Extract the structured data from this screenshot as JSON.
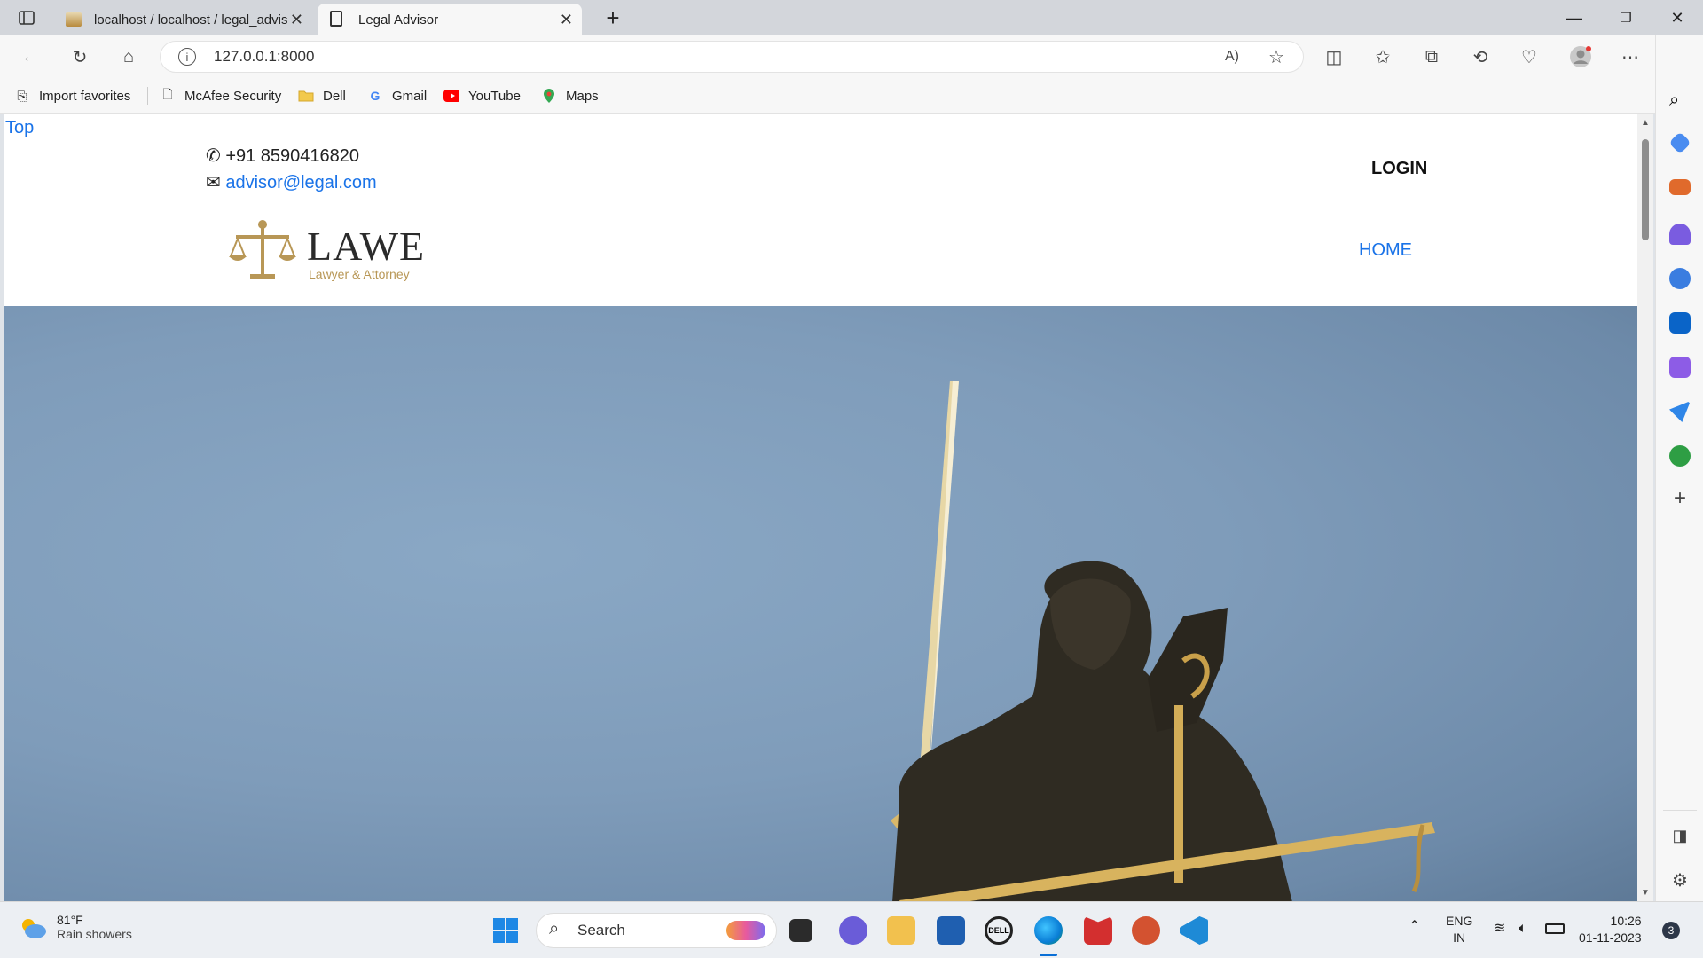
{
  "browser": {
    "tabs": [
      {
        "title": "localhost / localhost / legal_advis"
      },
      {
        "title": "Legal Advisor"
      }
    ],
    "url": "127.0.0.1:8000",
    "favorites": [
      {
        "label": "Import favorites",
        "icon": "import-icon"
      },
      {
        "label": "McAfee Security",
        "icon": "page-icon"
      },
      {
        "label": "Dell",
        "icon": "folder-icon"
      },
      {
        "label": "Gmail",
        "icon": "google-icon"
      },
      {
        "label": "YouTube",
        "icon": "youtube-icon"
      },
      {
        "label": "Maps",
        "icon": "maps-icon"
      }
    ]
  },
  "page": {
    "top_link": "Top",
    "phone": "+91 8590416820",
    "email": "advisor@legal.com",
    "login": "LOGIN",
    "nav_home": "HOME",
    "logo_title": "LAWE",
    "logo_subtitle": "Lawyer & Attorney"
  },
  "taskbar": {
    "weather_temp": "81°F",
    "weather_desc": "Rain showers",
    "search_placeholder": "Search",
    "lang": "ENG",
    "region": "IN",
    "time": "10:26",
    "date": "01-11-2023",
    "notification_count": "3"
  },
  "colors": {
    "link": "#1a73e8",
    "logo_gold": "#b89756"
  }
}
